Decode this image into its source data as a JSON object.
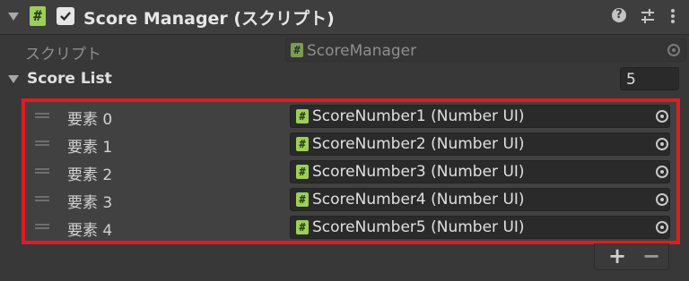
{
  "component": {
    "title": "Score Manager (スクリプト)",
    "enabled": true,
    "header_icons": [
      "help-icon",
      "presets-icon",
      "more-menu-icon"
    ]
  },
  "script_field": {
    "label": "スクリプト",
    "value": "ScoreManager"
  },
  "score_list": {
    "label": "Score List",
    "size": "5",
    "items": [
      {
        "label": "要素 0",
        "value": "ScoreNumber1 (Number UI)"
      },
      {
        "label": "要素 1",
        "value": "ScoreNumber2 (Number UI)"
      },
      {
        "label": "要素 2",
        "value": "ScoreNumber3 (Number UI)"
      },
      {
        "label": "要素 3",
        "value": "ScoreNumber4 (Number UI)"
      },
      {
        "label": "要素 4",
        "value": "ScoreNumber5 (Number UI)"
      }
    ],
    "add_label": "+",
    "remove_label": "−"
  },
  "colors": {
    "highlight_border": "#e21a23",
    "script_icon": "#9ccf5a",
    "background": "#383838"
  }
}
